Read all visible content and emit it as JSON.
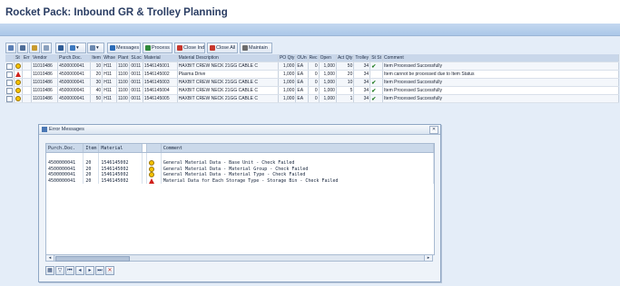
{
  "title": "Rocket Pack: Inbound GR & Trolley Planning",
  "colors": {
    "accent": "#aac7e8",
    "header_title": "#2a3d63",
    "error": "#d0201a",
    "warning": "#f4c200",
    "success": "#1f7a1f"
  },
  "toolbar": {
    "items": [
      {
        "name": "select-all-button",
        "label": "",
        "icon": "table-select-icon"
      },
      {
        "name": "filter-button",
        "label": "",
        "icon": "filter-icon"
      },
      {
        "name": "sum-button",
        "label": "",
        "icon": "sum-icon"
      },
      {
        "name": "layout-button",
        "label": "",
        "icon": "layout-icon"
      },
      {
        "name": "print-button",
        "label": "",
        "icon": "print-icon"
      },
      {
        "name": "export-button",
        "label": "",
        "icon": "export-icon"
      },
      {
        "name": "view-button",
        "label": "",
        "icon": "view-icon"
      },
      {
        "name": "messages-button",
        "label": "Messages",
        "icon": "messages-icon"
      },
      {
        "name": "process-button",
        "label": "Process",
        "icon": "process-icon"
      },
      {
        "name": "close-ind-button",
        "label": "Close Ind",
        "icon": "close-ind-icon"
      },
      {
        "name": "close-all-button",
        "label": "Close All",
        "icon": "close-all-icon"
      },
      {
        "name": "maintain-button",
        "label": "Maintain",
        "icon": "maintain-icon"
      }
    ]
  },
  "grid": {
    "columns": [
      "",
      "St",
      "Err",
      "Vendor",
      "Purch.Doc.",
      "Item",
      "Whse",
      "Plant",
      "SLoc",
      "Material",
      "Material Description",
      "PO Qty",
      "OUn",
      "Rec",
      "Open",
      "Act Qty",
      "Trolley",
      "St St",
      "Comment"
    ],
    "rows": [
      {
        "status": "warning",
        "vendor": "11010486",
        "po": "4500000041",
        "item": "10",
        "whse": "H11",
        "plant": "1100",
        "sloc": "0011",
        "material": "1546145001",
        "desc": "HAXBIT CREW NECK 21GG CABLE C",
        "po_qty": "1,000",
        "oun": "EA",
        "rec": "0",
        "open": "1,000",
        "act_qty": "50",
        "trolley": "34",
        "ok": true,
        "comment": "Item Processed Successfully"
      },
      {
        "status": "error",
        "vendor": "11010486",
        "po": "4500000041",
        "item": "20",
        "whse": "H11",
        "plant": "1100",
        "sloc": "0011",
        "material": "1546145002",
        "desc": "Plasma Drive",
        "po_qty": "1,000",
        "oun": "EA",
        "rec": "0",
        "open": "1,000",
        "act_qty": "20",
        "trolley": "34",
        "ok": false,
        "comment": "Item cannot be processed due to Item Status"
      },
      {
        "status": "warning",
        "vendor": "11010486",
        "po": "4500000041",
        "item": "30",
        "whse": "H11",
        "plant": "1100",
        "sloc": "0011",
        "material": "1546145003",
        "desc": "HAXBIT CREW NECK 21GG CABLE C",
        "po_qty": "1,000",
        "oun": "EA",
        "rec": "0",
        "open": "1,000",
        "act_qty": "10",
        "trolley": "34",
        "ok": true,
        "comment": "Item Processed Successfully"
      },
      {
        "status": "warning",
        "vendor": "11010486",
        "po": "4500000041",
        "item": "40",
        "whse": "H11",
        "plant": "1100",
        "sloc": "0011",
        "material": "1546145004",
        "desc": "HAXBIT CREW NECK 21GG CABLE C",
        "po_qty": "1,000",
        "oun": "EA",
        "rec": "0",
        "open": "1,000",
        "act_qty": "5",
        "trolley": "34",
        "ok": true,
        "comment": "Item Processed Successfully"
      },
      {
        "status": "warning",
        "vendor": "11010486",
        "po": "4500000041",
        "item": "50",
        "whse": "H11",
        "plant": "1100",
        "sloc": "0011",
        "material": "1546145005",
        "desc": "HAXBIT CREW NECK 21GG CABLE C",
        "po_qty": "1,000",
        "oun": "EA",
        "rec": "0",
        "open": "1,000",
        "act_qty": "1",
        "trolley": "34",
        "ok": true,
        "comment": "Item Processed Successfully"
      }
    ]
  },
  "dialog": {
    "title": "Error Messages",
    "columns": [
      "Purch.Doc.",
      "Item",
      "Material",
      "",
      "Comment"
    ],
    "rows": [
      {
        "po": "4500000041",
        "item": "20",
        "material": "1546145002",
        "type": "warning",
        "comment": "General Material Data - Base Unit - Check Failed"
      },
      {
        "po": "4500000041",
        "item": "20",
        "material": "1546145002",
        "type": "warning",
        "comment": "General Material Data - Material Group - Check Failed"
      },
      {
        "po": "4500000041",
        "item": "20",
        "material": "1546145002",
        "type": "warning",
        "comment": "General Material Data - Material Type - Check Failed"
      },
      {
        "po": "4500000041",
        "item": "20",
        "material": "1546145002",
        "type": "error",
        "comment": "Material Data for Each Storage Type - Storage Bin - Check Failed"
      }
    ]
  }
}
